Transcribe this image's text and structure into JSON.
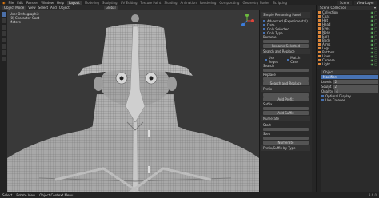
{
  "topbar": {
    "menus": [
      "File",
      "Edit",
      "Render",
      "Window",
      "Help"
    ],
    "workspaces": [
      "Layout",
      "Modeling",
      "Sculpting",
      "UV Editing",
      "Texture Paint",
      "Shading",
      "Animation",
      "Rendering",
      "Compositing",
      "Geometry Nodes",
      "Scripting"
    ],
    "active_workspace": "Layout",
    "scene": "Scene",
    "view_layer": "View Layer"
  },
  "header2": {
    "mode": "Object Mode",
    "items": [
      "View",
      "Select",
      "Add",
      "Object"
    ],
    "transform": "Global"
  },
  "viewport": {
    "overlay_line1": "User Orthographic",
    "overlay_line2": "(0) Character Coat",
    "overlay_line3": "Meters"
  },
  "npanel": {
    "header": "Simple Renaming Panel",
    "opt1": "Advanced (Experimental)",
    "opt2": "Data",
    "opt3": "Only Selected",
    "opt4": "Only Type",
    "rename_label": "Rename",
    "rename_btn": "Rename Selected",
    "search_header": "Search and Replace",
    "use_regex": "Use Regex",
    "match_case": "Match Case",
    "search_label": "Search",
    "replace_label": "Replace",
    "replace_btn": "Search and Replace",
    "prefix_header": "Prefix",
    "add_prefix_btn": "Add Prefix",
    "suffix_label": "Suffix",
    "add_suffix_btn": "Add Suffix",
    "numerate_header": "Numerate",
    "start_label": "Start",
    "step_label": "Step",
    "numerate_btn": "Numerate",
    "prefix_suffix_by_type": "Prefix/Suffix by Type"
  },
  "outliner": {
    "title": "Scene Collection",
    "items": [
      "Collection",
      "Coat",
      "Hat",
      "Head",
      "Eyes",
      "Nose",
      "Ears",
      "Body",
      "Arms",
      "Legs",
      "Buttons",
      "Lines",
      "Camera",
      "Light"
    ]
  },
  "props": {
    "tab": "Object",
    "blue_bar": "Modifiers",
    "row1_label": "Levels",
    "row1_value": "2",
    "row2_label": "Sculpt",
    "row2_value": "2",
    "row3_label": "Quality",
    "row3_value": "4",
    "chk1": "Optimal Display",
    "chk2": "Use Creases"
  },
  "status": {
    "items": [
      "Select",
      "Rotate View",
      "Object Context Menu"
    ],
    "version": "3.6.0"
  },
  "colors": {
    "accent": "#4772b3",
    "viewport_bg": "#393939",
    "mesh": "#9a9a9a",
    "outline_orange": "#e0883a"
  }
}
